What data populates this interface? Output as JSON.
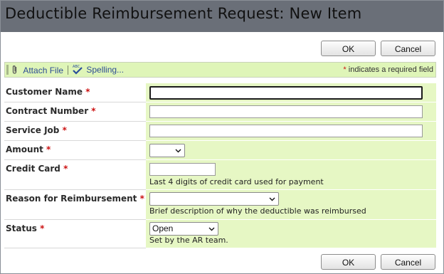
{
  "window": {
    "title": "Deductible Reimbursement Request: New Item"
  },
  "buttons": {
    "ok": "OK",
    "cancel": "Cancel"
  },
  "toolbar": {
    "attach_file": "Attach File",
    "spelling": "Spelling...",
    "required_star": "*",
    "required_note": " indicates a required field"
  },
  "fields": [
    {
      "label": "Customer Name",
      "required": "*",
      "type": "text",
      "value": ""
    },
    {
      "label": "Contract Number",
      "required": "*",
      "type": "text",
      "value": ""
    },
    {
      "label": "Service Job",
      "required": "*",
      "type": "text",
      "value": ""
    },
    {
      "label": "Amount",
      "required": "*",
      "type": "select",
      "value": ""
    },
    {
      "label": "Credit Card",
      "required": "*",
      "type": "text",
      "value": "",
      "help": "Last 4 digits of credit card used for payment"
    },
    {
      "label": "Reason for Reimbursement",
      "required": "*",
      "type": "select",
      "value": "",
      "help": "Brief description of why the deductible was reimbursed"
    },
    {
      "label": "Status",
      "required": "*",
      "type": "select",
      "value": "Open",
      "help": "Set by the AR team."
    }
  ],
  "colors": {
    "titlebar": "#6a6f78",
    "toolbar_bg": "#dff5b8",
    "value_cell_bg": "#e6f7c4",
    "required_star": "#cc1111",
    "link": "#2e4d94"
  },
  "icons": {
    "attach": "paperclip-icon",
    "spelling": "spellcheck-icon",
    "dropdown": "chevron-down-icon"
  }
}
